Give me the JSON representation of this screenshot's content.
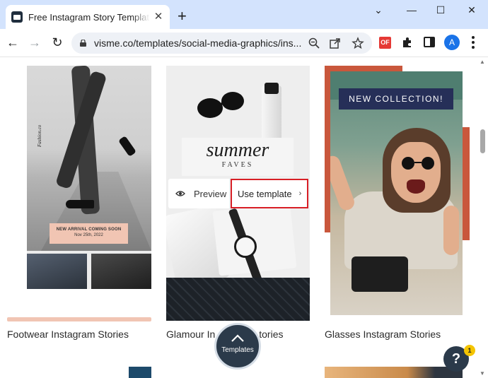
{
  "browser": {
    "tab": {
      "title": "Free Instagram Story Templates t",
      "close": "✕"
    },
    "new_tab": "+",
    "window": {
      "dropdown": "⌄",
      "minimize": "—",
      "maximize": "☐",
      "close": "✕"
    },
    "nav": {
      "back": "←",
      "forward": "→",
      "reload": "↻"
    },
    "url": "visme.co/templates/social-media-graphics/ins...",
    "extensions": {
      "of_label": "OF",
      "avatar_letter": "A"
    }
  },
  "page": {
    "cards": [
      {
        "title": "Footwear Instagram Stories",
        "brand_text": "Fashion.co",
        "badge_line1": "NEW ARRIVAL COMING SOON",
        "badge_line2": "Nov 25th, 2022"
      },
      {
        "title": "Glamour Instagram Stories",
        "title_visible_left": "Glamour In",
        "title_visible_right": "tories",
        "headline": "summer",
        "subheadline": "FAVES"
      },
      {
        "title": "Glasses Instagram Stories",
        "banner": "NEW COLLECTION!"
      }
    ],
    "hover_actions": {
      "preview_label": "Preview",
      "use_template_label": "Use template"
    },
    "templates_button": "Templates",
    "help": {
      "label": "?",
      "badge_count": "1"
    },
    "scrollbar": {
      "up": "▲",
      "down": "▼"
    }
  },
  "colors": {
    "accent_red": "#d81f26",
    "navy": "#2b3a4a",
    "collection_banner": "#262f58",
    "peach": "#f1c5b3",
    "terracotta": "#c9573c"
  }
}
